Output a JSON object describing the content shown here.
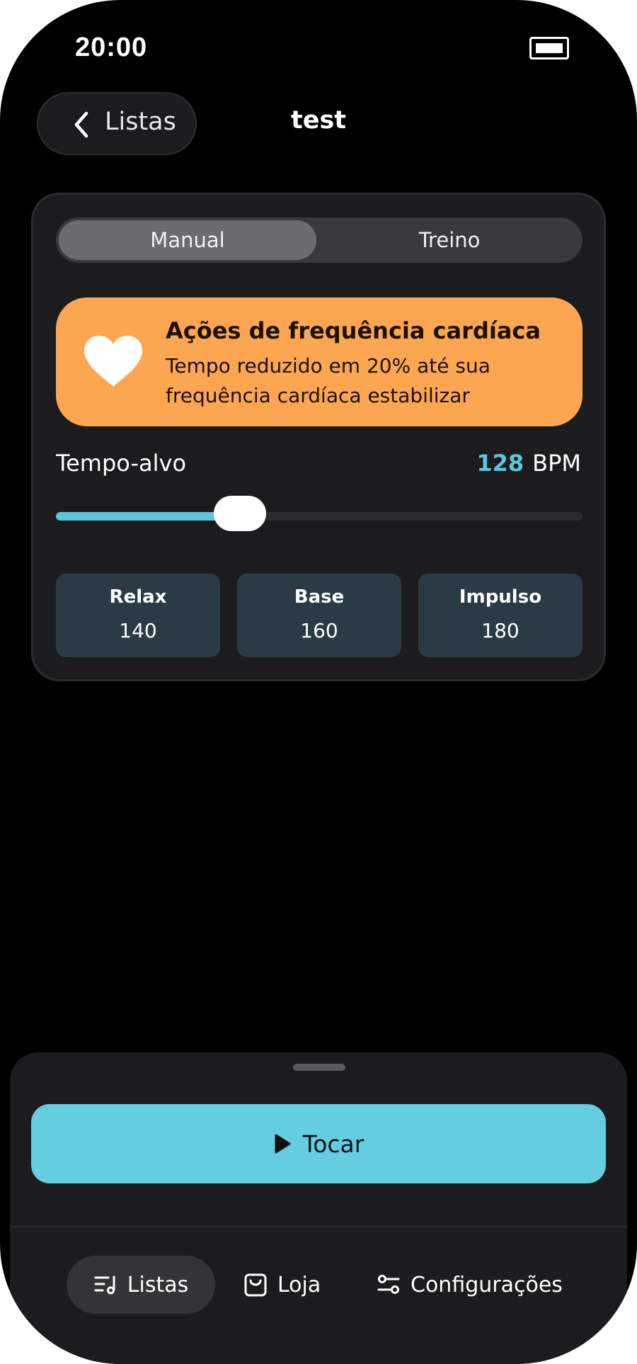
{
  "status_bar": {
    "time": "20:00",
    "battery_icon": "battery-icon"
  },
  "nav": {
    "back_label": "Listas",
    "title": "test"
  },
  "segmented": {
    "options": [
      "Manual",
      "Treino"
    ],
    "selected": "Manual"
  },
  "hr_banner": {
    "icon": "heart-icon",
    "title": "Ações de frequência cardíaca",
    "description": "Tempo reduzido em 20% até sua frequência cardíaca estabilizar",
    "color": "#fca652"
  },
  "tempo": {
    "label": "Tempo-alvo",
    "value": "128",
    "unit": "BPM",
    "slider_fraction": 0.35,
    "accent": "#5cc6de"
  },
  "presets": [
    {
      "name": "Relax",
      "value": "140"
    },
    {
      "name": "Base",
      "value": "160"
    },
    {
      "name": "Impulso",
      "value": "180"
    }
  ],
  "player": {
    "play_label": "Tocar",
    "play_icon": "play-icon",
    "color": "#64cde0"
  },
  "tabbar": {
    "items": [
      {
        "label": "Listas",
        "icon": "playlist-icon",
        "active": true
      },
      {
        "label": "Loja",
        "icon": "shopping-bag-icon",
        "active": false
      },
      {
        "label": "Configurações",
        "icon": "sliders-icon",
        "active": false
      }
    ]
  }
}
